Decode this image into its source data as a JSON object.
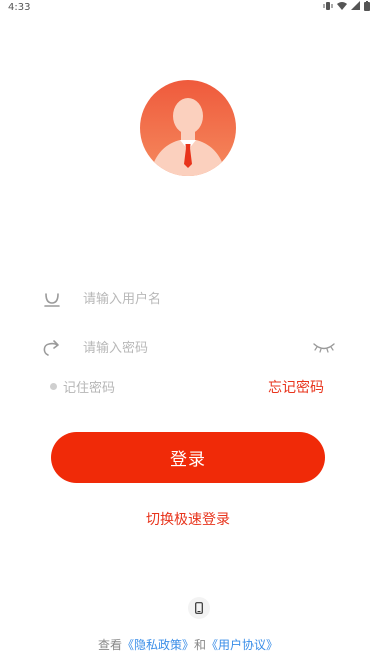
{
  "status": {
    "time": "4:33"
  },
  "login": {
    "username_placeholder": "请输入用户名",
    "password_placeholder": "请输入密码",
    "remember_label": "记住密码",
    "forgot_label": "忘记密码",
    "login_button": "登录",
    "switch_label": "切换极速登录"
  },
  "agreement": {
    "prefix": "查看",
    "privacy": "《隐私政策》",
    "and": "和",
    "terms": "《用户协议》"
  },
  "icons": {
    "avatar": "user-avatar-icon",
    "user": "user-icon",
    "lock": "lock-icon",
    "eye": "eye-closed-icon",
    "phone": "phone-icon"
  },
  "colors": {
    "accent": "#f02a08",
    "link": "#3a8ee8",
    "avatar_top": "#ef5a3c",
    "avatar_bottom": "#f58a5e"
  }
}
